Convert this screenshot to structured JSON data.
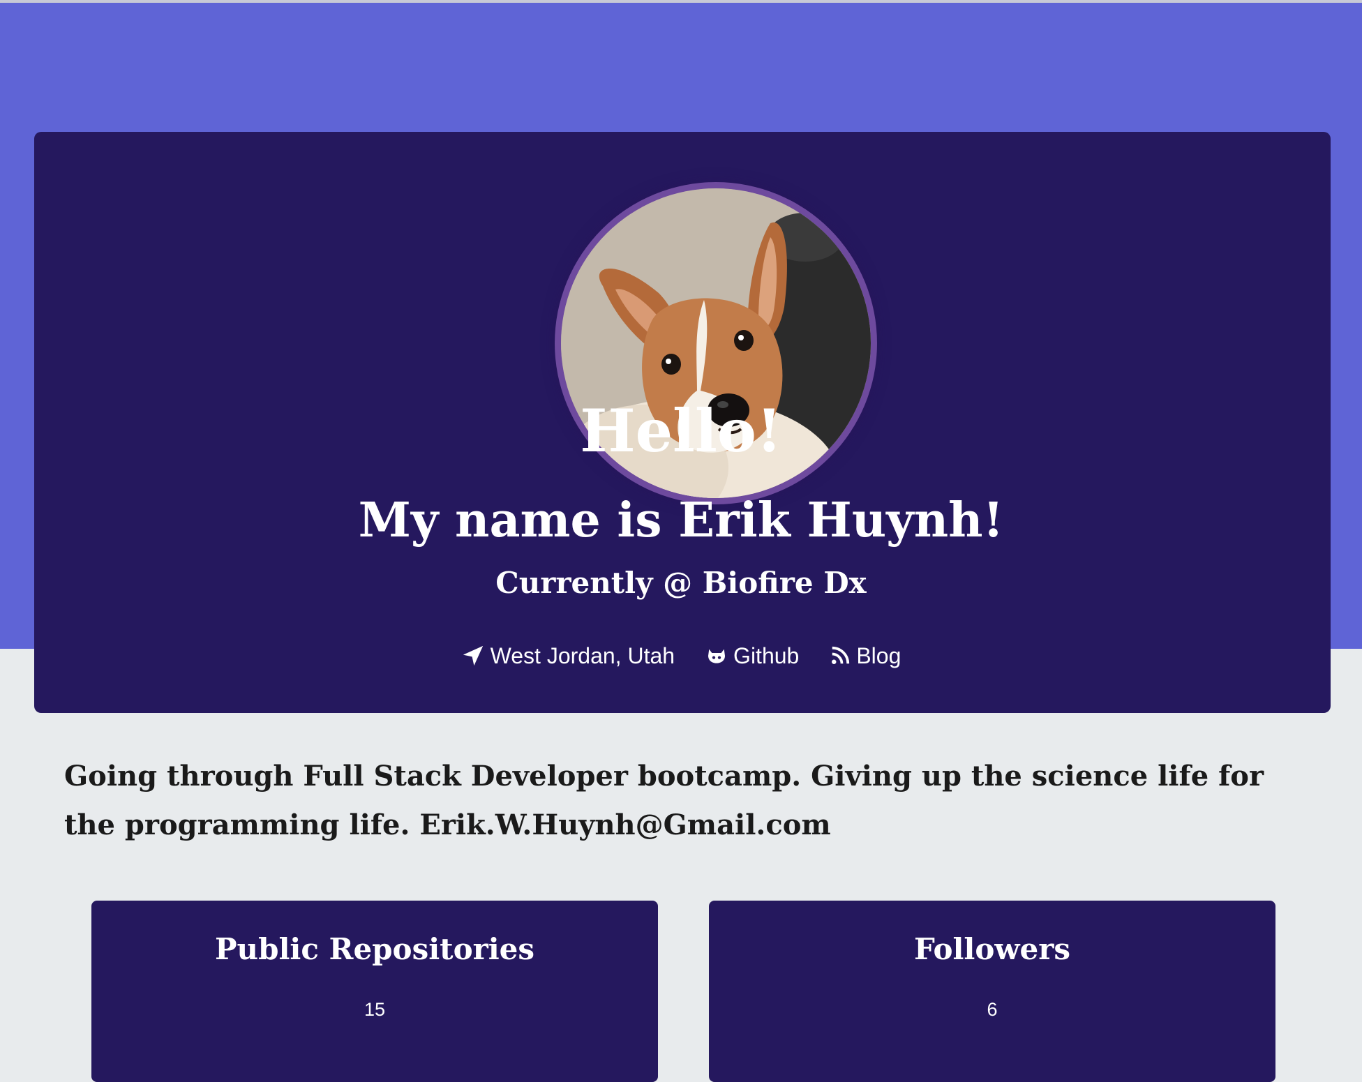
{
  "colors": {
    "hero_band": "#5f64d6",
    "card_background": "#25185e",
    "page_background": "#e8ebed",
    "avatar_ring": "#6e4a9e",
    "text_light": "#ffffff",
    "text_dark": "#1a1a1a"
  },
  "profile": {
    "avatar_icon": "avatar-photo-corgi",
    "greeting": "Hello!",
    "name_line": "My name is Erik Huynh!",
    "company_line": "Currently @ Biofire Dx"
  },
  "links": {
    "location": {
      "icon": "location-arrow-icon",
      "label": "West Jordan, Utah"
    },
    "github": {
      "icon": "github-icon",
      "label": "Github"
    },
    "blog": {
      "icon": "rss-icon",
      "label": "Blog"
    }
  },
  "bio": "Going through Full Stack Developer bootcamp. Giving up the science life for the programming life. Erik.W.Huynh@Gmail.com",
  "stats": [
    {
      "title": "Public Repositories",
      "value": "15"
    },
    {
      "title": "Followers",
      "value": "6"
    }
  ]
}
